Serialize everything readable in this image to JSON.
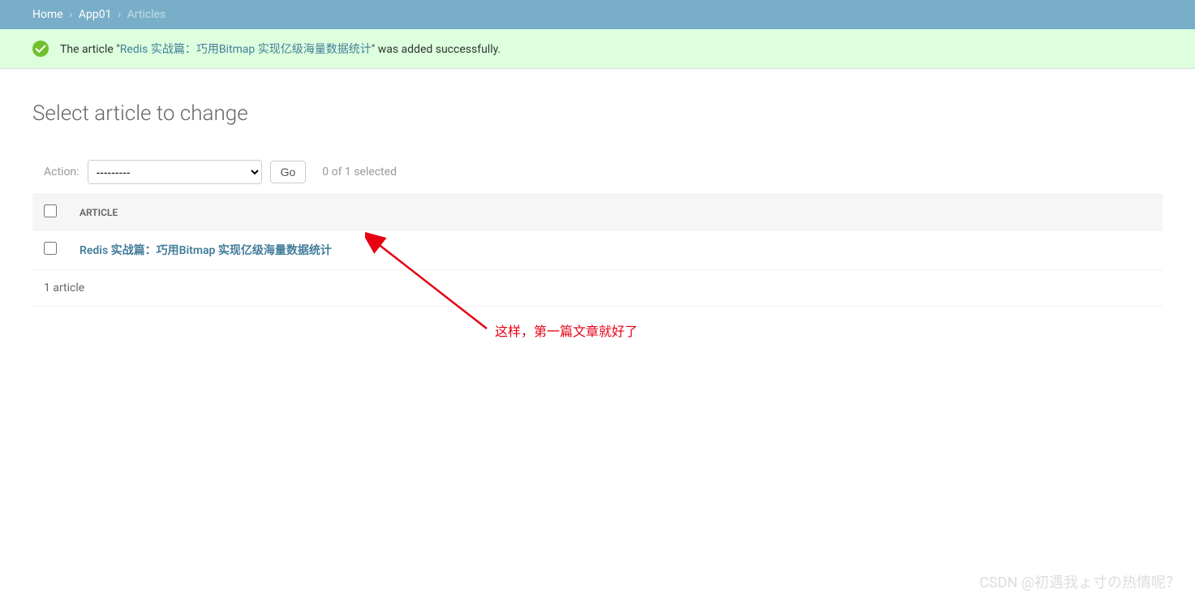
{
  "breadcrumbs": {
    "home": "Home",
    "app": "App01",
    "current": "Articles"
  },
  "message": {
    "prefix": "The article \"",
    "link": "Redis 实战篇：巧用Bitmap 实现亿级海量数据统计",
    "suffix": "\" was added successfully."
  },
  "page_title": "Select article to change",
  "actions": {
    "label": "Action:",
    "placeholder": "---------",
    "go": "Go",
    "counter": "0 of 1 selected"
  },
  "table": {
    "header": "ARTICLE",
    "rows": [
      {
        "title": "Redis 实战篇：巧用Bitmap 实现亿级海量数据统计"
      }
    ]
  },
  "paginator": "1 article",
  "annotation": "这样，第一篇文章就好了",
  "watermark": "CSDN @初遇我ょ寸の热情呢？"
}
